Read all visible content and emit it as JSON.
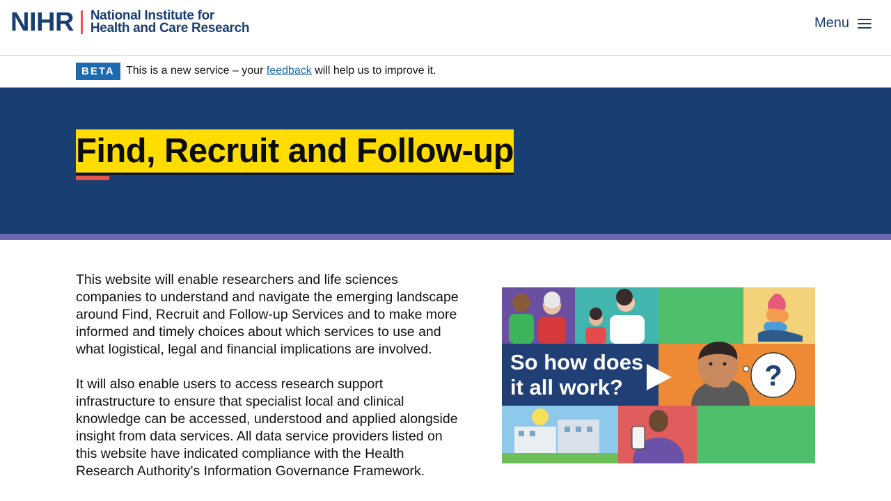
{
  "header": {
    "logo_mark": "NIHR",
    "logo_line1": "National Institute for",
    "logo_line2": "Health and Care Research",
    "menu_label": "Menu"
  },
  "beta": {
    "tag": "BETA",
    "text_before": "This is a new service – your ",
    "link_text": "feedback",
    "text_after": " will help us to improve it."
  },
  "hero": {
    "title": "Find, Recruit and Follow-up"
  },
  "intro": {
    "paragraph1": "This website will enable researchers and life sciences companies to understand and navigate the emerging landscape around Find, Recruit and Follow-up Services and to make more informed and timely choices about which services to use and what logistical, legal and financial implications are involved.",
    "paragraph2": "It will also enable users to access research support infrastructure to ensure that specialist local and clinical knowledge can be accessed, understood and applied alongside insight from data services. All data service providers listed on this website have indicated compliance with the Health Research Authority's Information Governance Framework."
  },
  "video": {
    "line1": "So how does",
    "line2": "it all work?",
    "question_mark": "?"
  },
  "colors": {
    "navy": "#193e72",
    "coral": "#e5574f",
    "yellow": "#ffdd00",
    "purple": "#6e69b0",
    "link_blue": "#1d6ab1"
  }
}
